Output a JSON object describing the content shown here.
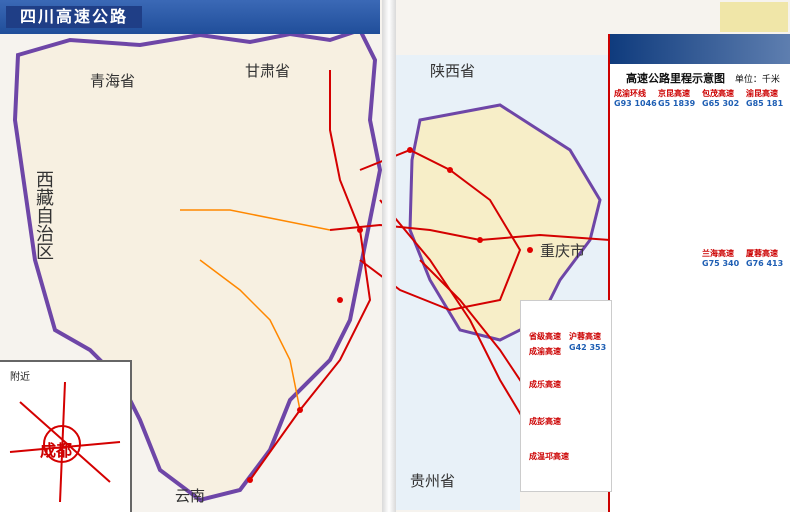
{
  "title": "四川高速公路",
  "provinces": {
    "qinghai": "青海省",
    "gansu": "甘肃省",
    "shaanxi": "陕西省",
    "xizang": "西藏自治区",
    "chongqing": "重庆市",
    "yunnan": "云南",
    "guizhou": "贵州省"
  },
  "chart_title": "高速公路里程示意图",
  "unit": "单位：千米",
  "highways": [
    {
      "name": "成渝环线",
      "code": "G93 1046"
    },
    {
      "name": "京昆高速",
      "code": "G5 1839"
    },
    {
      "name": "包茂高速",
      "code": "G65 302"
    },
    {
      "name": "渝昆高速",
      "code": "G85 181"
    },
    {
      "name": "兰海高速",
      "code": "G75 340"
    },
    {
      "name": "厦蓉高速",
      "code": "G76 413"
    }
  ],
  "bottom_routes": [
    {
      "name": "省级高速"
    },
    {
      "name": "沪蓉高速",
      "code": "G42 353"
    },
    {
      "name": "成渝高速"
    },
    {
      "name": "成乐高速"
    },
    {
      "name": "成彭高速"
    },
    {
      "name": "成温邛高速"
    }
  ],
  "inset": {
    "title": "附近",
    "city": "成都"
  }
}
